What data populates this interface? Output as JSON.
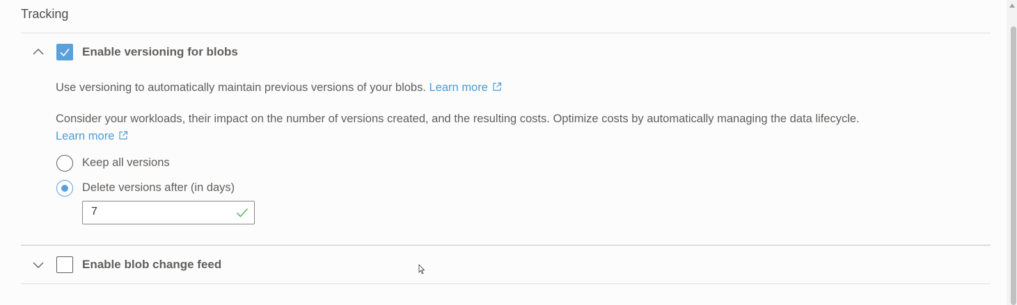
{
  "section": {
    "title": "Tracking"
  },
  "versioning": {
    "label": "Enable versioning for blobs",
    "checked": true,
    "expanded": true,
    "description": "Use versioning to automatically maintain previous versions of your blobs.",
    "learn_more_1": "Learn more",
    "consider_text": "Consider your workloads, their impact on the number of versions created, and the resulting costs. Optimize costs by automatically managing the data lifecycle.",
    "learn_more_2": "Learn more",
    "options": [
      {
        "label": "Keep all versions",
        "selected": false
      },
      {
        "label": "Delete versions after (in days)",
        "selected": true
      }
    ],
    "days_value": "7"
  },
  "change_feed": {
    "label": "Enable blob change feed",
    "checked": false,
    "expanded": false
  },
  "icons": {
    "chevron_up": "chevron-up-icon",
    "chevron_down": "chevron-down-icon",
    "checkmark": "checkmark-icon",
    "external_link": "external-link-icon",
    "validation": "valid-check-icon"
  },
  "colors": {
    "accent": "#5aa1dc",
    "link": "#4a9bd6",
    "valid": "#5cb85c",
    "text": "#605e5c"
  }
}
